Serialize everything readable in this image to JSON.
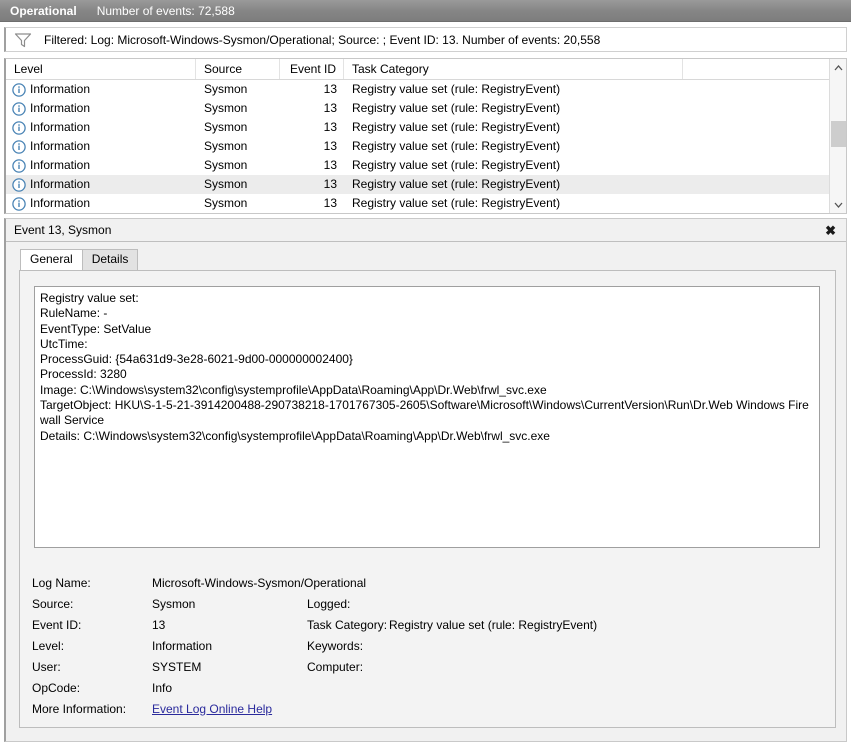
{
  "topbar": {
    "title": "Operational",
    "events_label": "Number of events: 72,588"
  },
  "filter": {
    "icon": "funnel-icon",
    "text": "Filtered: Log: Microsoft-Windows-Sysmon/Operational; Source: ; Event ID: 13. Number of events: 20,558"
  },
  "event_list": {
    "columns": [
      "Level",
      "Source",
      "Event ID",
      "Task Category"
    ],
    "rows": [
      {
        "level": "Information",
        "source": "Sysmon",
        "event_id": "13",
        "task_category": "Registry value set (rule: RegistryEvent)",
        "selected": false
      },
      {
        "level": "Information",
        "source": "Sysmon",
        "event_id": "13",
        "task_category": "Registry value set (rule: RegistryEvent)",
        "selected": false
      },
      {
        "level": "Information",
        "source": "Sysmon",
        "event_id": "13",
        "task_category": "Registry value set (rule: RegistryEvent)",
        "selected": false
      },
      {
        "level": "Information",
        "source": "Sysmon",
        "event_id": "13",
        "task_category": "Registry value set (rule: RegistryEvent)",
        "selected": false
      },
      {
        "level": "Information",
        "source": "Sysmon",
        "event_id": "13",
        "task_category": "Registry value set (rule: RegistryEvent)",
        "selected": false
      },
      {
        "level": "Information",
        "source": "Sysmon",
        "event_id": "13",
        "task_category": "Registry value set (rule: RegistryEvent)",
        "selected": true
      },
      {
        "level": "Information",
        "source": "Sysmon",
        "event_id": "13",
        "task_category": "Registry value set (rule: RegistryEvent)",
        "selected": false
      }
    ]
  },
  "detail": {
    "title": "Event 13, Sysmon",
    "close_label": "✖",
    "tabs": [
      {
        "label": "General",
        "active": true
      },
      {
        "label": "Details",
        "active": false
      }
    ],
    "body_text": "Registry value set:\nRuleName: -\nEventType: SetValue\nUtcTime:\nProcessGuid: {54a631d9-3e28-6021-9d00-000000002400}\nProcessId: 3280\nImage: C:\\Windows\\system32\\config\\systemprofile\\AppData\\Roaming\\App\\Dr.Web\\frwl_svc.exe\nTargetObject: HKU\\S-1-5-21-3914200488-290738218-1701767305-2605\\Software\\Microsoft\\Windows\\CurrentVersion\\Run\\Dr.Web Windows Firewall Service\nDetails: C:\\Windows\\system32\\config\\systemprofile\\AppData\\Roaming\\App\\Dr.Web\\frwl_svc.exe"
  },
  "meta": {
    "log_name_label": "Log Name:",
    "log_name_value": "Microsoft-Windows-Sysmon/Operational",
    "source_label": "Source:",
    "source_value": "Sysmon",
    "logged_label": "Logged:",
    "logged_value": "",
    "event_id_label": "Event ID:",
    "event_id_value": "13",
    "task_category_label": "Task Category:",
    "task_category_value": "Registry value set (rule: RegistryEvent)",
    "level_label": "Level:",
    "level_value": "Information",
    "keywords_label": "Keywords:",
    "keywords_value": "",
    "user_label": "User:",
    "user_value": "SYSTEM",
    "computer_label": "Computer:",
    "computer_value": "",
    "opcode_label": "OpCode:",
    "opcode_value": "Info",
    "more_info_label": "More Information:",
    "more_info_link": "Event Log Online Help"
  },
  "colors": {
    "topbar": "#868686",
    "selected_row": "#ececec",
    "link": "#2a2a9c",
    "info_icon": "#4a84b5"
  }
}
